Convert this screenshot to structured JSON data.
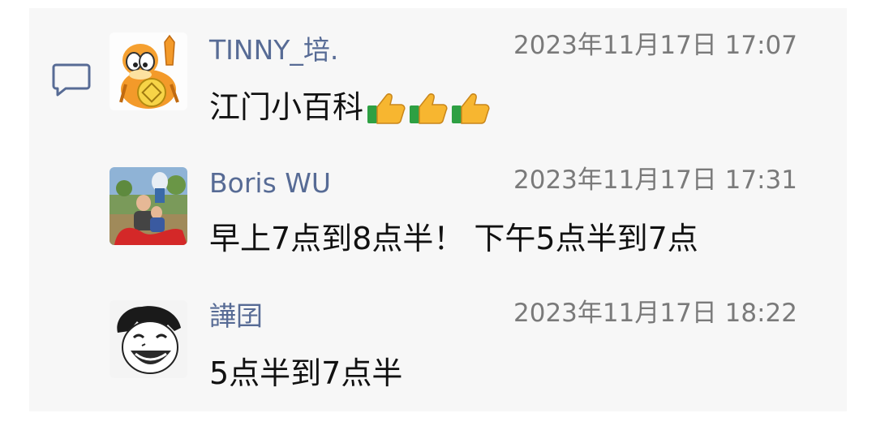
{
  "comments": [
    {
      "author": "TINNY_培.",
      "timestamp": "2023年11月17日 17:07",
      "text": "江门小百科",
      "emoji": [
        "thumbs-up",
        "thumbs-up",
        "thumbs-up"
      ]
    },
    {
      "author": "Boris WU",
      "timestamp": "2023年11月17日 17:31",
      "text": "早上7点到8点半！ 下午5点半到7点"
    },
    {
      "author": "譁囝",
      "timestamp": "2023年11月17日 18:22",
      "text": "5点半到7点半"
    }
  ],
  "icons": {
    "comment": "comment-bubble-icon"
  },
  "colors": {
    "name": "#576b95",
    "timestamp": "#7a7a7a",
    "panel": "#f7f7f7"
  }
}
